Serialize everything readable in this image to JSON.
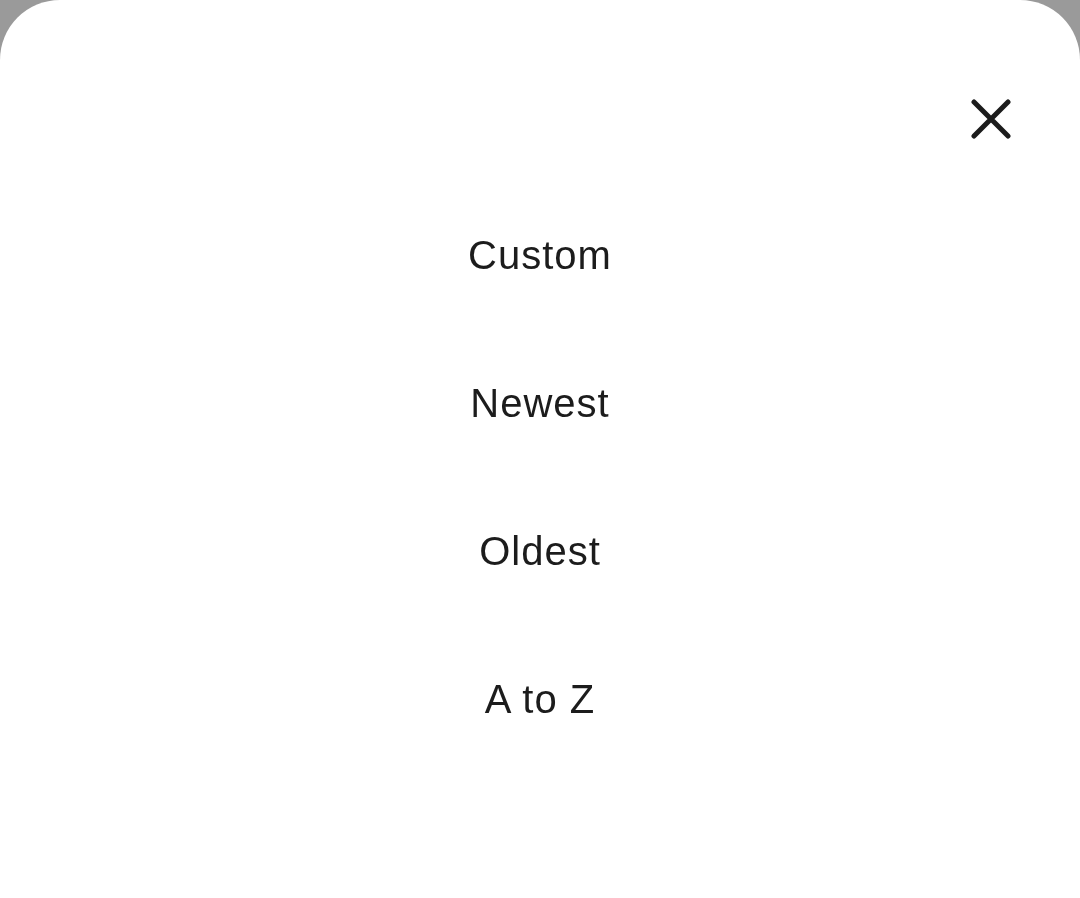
{
  "sort_options": [
    {
      "label": "Custom"
    },
    {
      "label": "Newest"
    },
    {
      "label": "Oldest"
    },
    {
      "label": "A to Z"
    }
  ]
}
